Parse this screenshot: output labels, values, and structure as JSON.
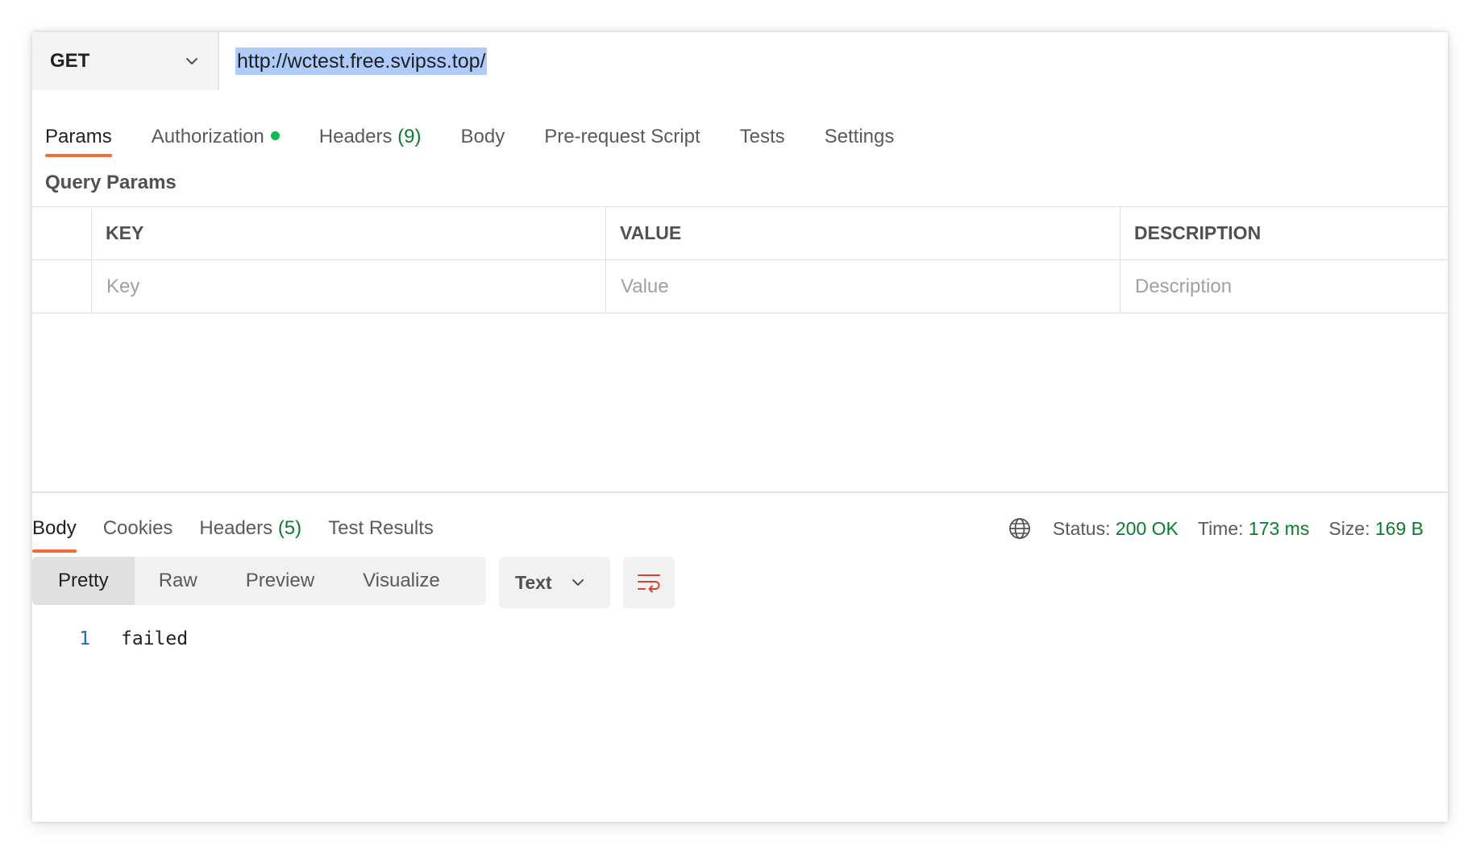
{
  "request": {
    "method": "GET",
    "url": "http://wctest.free.svipss.top/"
  },
  "request_tabs": [
    {
      "label": "Params",
      "active": true
    },
    {
      "label": "Authorization",
      "indicator": "dot"
    },
    {
      "label": "Headers",
      "count": "(9)"
    },
    {
      "label": "Body"
    },
    {
      "label": "Pre-request Script"
    },
    {
      "label": "Tests"
    },
    {
      "label": "Settings"
    }
  ],
  "params": {
    "title": "Query Params",
    "columns": [
      "KEY",
      "VALUE",
      "DESCRIPTION"
    ],
    "placeholders": [
      "Key",
      "Value",
      "Description"
    ]
  },
  "response_tabs": [
    {
      "label": "Body",
      "active": true
    },
    {
      "label": "Cookies"
    },
    {
      "label": "Headers",
      "count": "(5)"
    },
    {
      "label": "Test Results"
    }
  ],
  "response_meta": {
    "status_label": "Status:",
    "status_value": "200 OK",
    "time_label": "Time:",
    "time_value": "173 ms",
    "size_label": "Size:",
    "size_value": "169 B"
  },
  "format": {
    "modes": [
      "Pretty",
      "Raw",
      "Preview",
      "Visualize"
    ],
    "active": "Pretty",
    "language": "Text"
  },
  "code": {
    "line_number": "1",
    "content": "failed"
  },
  "colors": {
    "accent": "#f26b3a",
    "success": "#0a7d2c",
    "auth_dot": "#0cbb52",
    "url_selection": "#aecbfa",
    "wrap_icon": "#d9412e"
  },
  "icons": {
    "method_dropdown": "chevron-down-icon",
    "network": "globe-icon",
    "language_dropdown": "chevron-down-icon",
    "wrap": "text-wrap-icon"
  }
}
